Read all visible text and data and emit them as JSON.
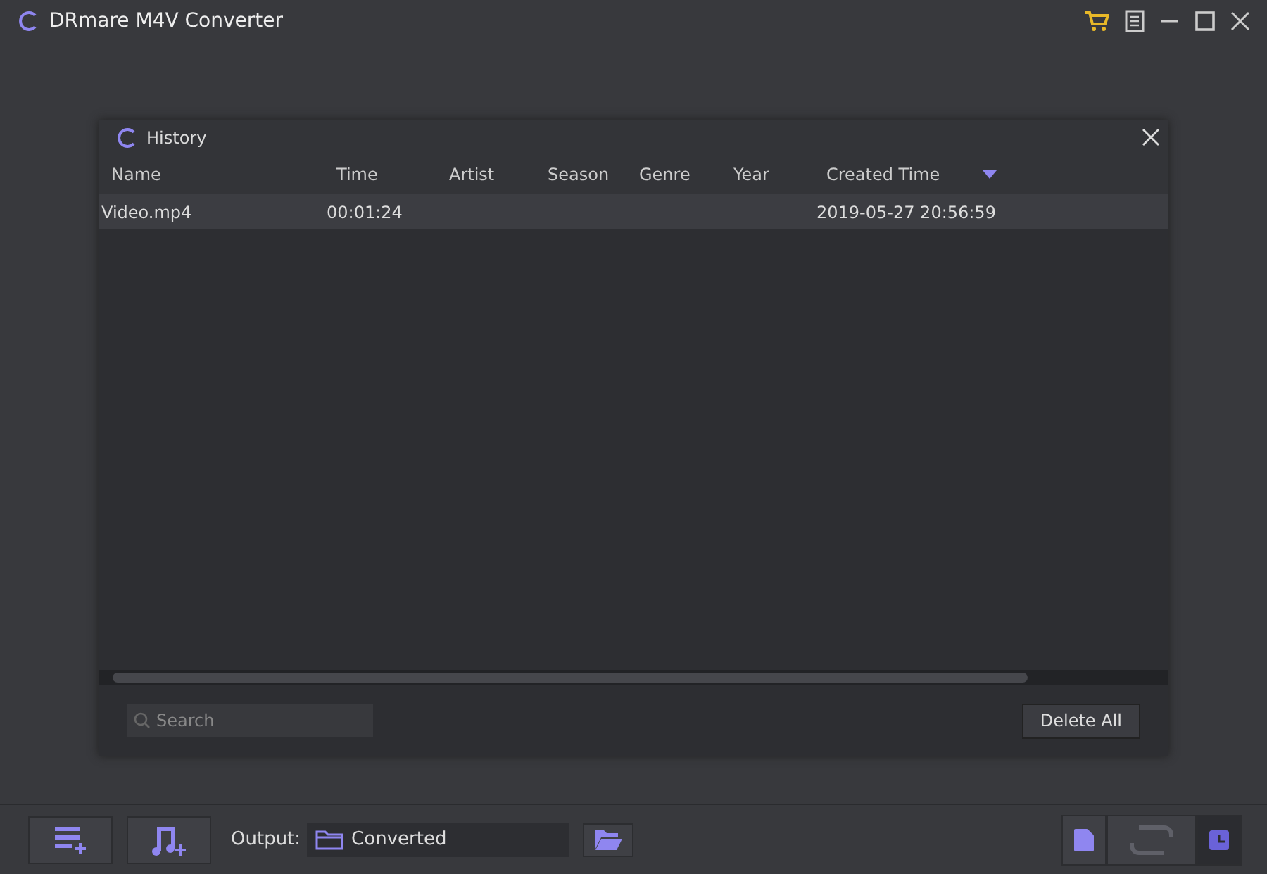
{
  "window": {
    "title": "DRmare M4V Converter"
  },
  "dialog": {
    "title": "History",
    "columns": [
      {
        "label": "Name",
        "sorted": false
      },
      {
        "label": "Time",
        "sorted": false
      },
      {
        "label": "Artist",
        "sorted": false
      },
      {
        "label": "Season",
        "sorted": false
      },
      {
        "label": "Genre",
        "sorted": false
      },
      {
        "label": "Year",
        "sorted": false
      },
      {
        "label": "Created Time",
        "sorted": true
      }
    ],
    "rows": [
      {
        "selected": true,
        "cells": [
          "Video.mp4",
          "00:01:24",
          "",
          "",
          "",
          "",
          "2019-05-27 20:56:59"
        ]
      }
    ],
    "search": {
      "placeholder": "Search"
    },
    "delete_button": "Delete All"
  },
  "bottom_bar": {
    "output_label": "Output:",
    "output_value": "Converted",
    "right_buttons": [
      {
        "kind": "file",
        "selected": false
      },
      {
        "kind": "convert",
        "selected": false
      },
      {
        "kind": "history",
        "selected": true
      }
    ]
  }
}
